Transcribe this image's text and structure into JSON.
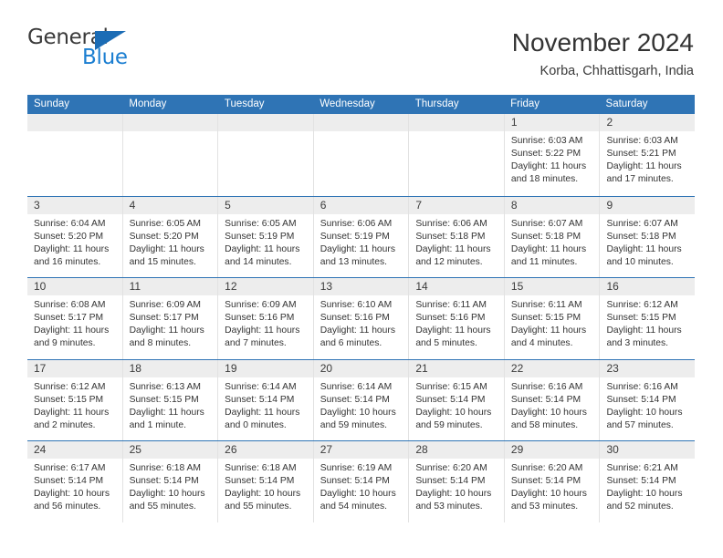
{
  "brand": {
    "name_part1": "General",
    "name_part2": "Blue",
    "triangle_color": "#1b6cb5",
    "blue_color": "#1b7ed1"
  },
  "header": {
    "title": "November 2024",
    "location": "Korba, Chhattisgarh, India"
  },
  "theme": {
    "header_bar": "#2f74b5",
    "daynum_band": "#ededed",
    "row_divider": "#2f74b5",
    "column_divider": "#e2e2e2"
  },
  "weekdays": [
    "Sunday",
    "Monday",
    "Tuesday",
    "Wednesday",
    "Thursday",
    "Friday",
    "Saturday"
  ],
  "weeks": [
    [
      {
        "day": "",
        "empty": true,
        "sunrise": "",
        "sunset": "",
        "daylight1": "",
        "daylight2": ""
      },
      {
        "day": "",
        "empty": true,
        "sunrise": "",
        "sunset": "",
        "daylight1": "",
        "daylight2": ""
      },
      {
        "day": "",
        "empty": true,
        "sunrise": "",
        "sunset": "",
        "daylight1": "",
        "daylight2": ""
      },
      {
        "day": "",
        "empty": true,
        "sunrise": "",
        "sunset": "",
        "daylight1": "",
        "daylight2": ""
      },
      {
        "day": "",
        "empty": true,
        "sunrise": "",
        "sunset": "",
        "daylight1": "",
        "daylight2": ""
      },
      {
        "day": "1",
        "empty": false,
        "sunrise": "Sunrise: 6:03 AM",
        "sunset": "Sunset: 5:22 PM",
        "daylight1": "Daylight: 11 hours",
        "daylight2": "and 18 minutes."
      },
      {
        "day": "2",
        "empty": false,
        "sunrise": "Sunrise: 6:03 AM",
        "sunset": "Sunset: 5:21 PM",
        "daylight1": "Daylight: 11 hours",
        "daylight2": "and 17 minutes."
      }
    ],
    [
      {
        "day": "3",
        "empty": false,
        "sunrise": "Sunrise: 6:04 AM",
        "sunset": "Sunset: 5:20 PM",
        "daylight1": "Daylight: 11 hours",
        "daylight2": "and 16 minutes."
      },
      {
        "day": "4",
        "empty": false,
        "sunrise": "Sunrise: 6:05 AM",
        "sunset": "Sunset: 5:20 PM",
        "daylight1": "Daylight: 11 hours",
        "daylight2": "and 15 minutes."
      },
      {
        "day": "5",
        "empty": false,
        "sunrise": "Sunrise: 6:05 AM",
        "sunset": "Sunset: 5:19 PM",
        "daylight1": "Daylight: 11 hours",
        "daylight2": "and 14 minutes."
      },
      {
        "day": "6",
        "empty": false,
        "sunrise": "Sunrise: 6:06 AM",
        "sunset": "Sunset: 5:19 PM",
        "daylight1": "Daylight: 11 hours",
        "daylight2": "and 13 minutes."
      },
      {
        "day": "7",
        "empty": false,
        "sunrise": "Sunrise: 6:06 AM",
        "sunset": "Sunset: 5:18 PM",
        "daylight1": "Daylight: 11 hours",
        "daylight2": "and 12 minutes."
      },
      {
        "day": "8",
        "empty": false,
        "sunrise": "Sunrise: 6:07 AM",
        "sunset": "Sunset: 5:18 PM",
        "daylight1": "Daylight: 11 hours",
        "daylight2": "and 11 minutes."
      },
      {
        "day": "9",
        "empty": false,
        "sunrise": "Sunrise: 6:07 AM",
        "sunset": "Sunset: 5:18 PM",
        "daylight1": "Daylight: 11 hours",
        "daylight2": "and 10 minutes."
      }
    ],
    [
      {
        "day": "10",
        "empty": false,
        "sunrise": "Sunrise: 6:08 AM",
        "sunset": "Sunset: 5:17 PM",
        "daylight1": "Daylight: 11 hours",
        "daylight2": "and 9 minutes."
      },
      {
        "day": "11",
        "empty": false,
        "sunrise": "Sunrise: 6:09 AM",
        "sunset": "Sunset: 5:17 PM",
        "daylight1": "Daylight: 11 hours",
        "daylight2": "and 8 minutes."
      },
      {
        "day": "12",
        "empty": false,
        "sunrise": "Sunrise: 6:09 AM",
        "sunset": "Sunset: 5:16 PM",
        "daylight1": "Daylight: 11 hours",
        "daylight2": "and 7 minutes."
      },
      {
        "day": "13",
        "empty": false,
        "sunrise": "Sunrise: 6:10 AM",
        "sunset": "Sunset: 5:16 PM",
        "daylight1": "Daylight: 11 hours",
        "daylight2": "and 6 minutes."
      },
      {
        "day": "14",
        "empty": false,
        "sunrise": "Sunrise: 6:11 AM",
        "sunset": "Sunset: 5:16 PM",
        "daylight1": "Daylight: 11 hours",
        "daylight2": "and 5 minutes."
      },
      {
        "day": "15",
        "empty": false,
        "sunrise": "Sunrise: 6:11 AM",
        "sunset": "Sunset: 5:15 PM",
        "daylight1": "Daylight: 11 hours",
        "daylight2": "and 4 minutes."
      },
      {
        "day": "16",
        "empty": false,
        "sunrise": "Sunrise: 6:12 AM",
        "sunset": "Sunset: 5:15 PM",
        "daylight1": "Daylight: 11 hours",
        "daylight2": "and 3 minutes."
      }
    ],
    [
      {
        "day": "17",
        "empty": false,
        "sunrise": "Sunrise: 6:12 AM",
        "sunset": "Sunset: 5:15 PM",
        "daylight1": "Daylight: 11 hours",
        "daylight2": "and 2 minutes."
      },
      {
        "day": "18",
        "empty": false,
        "sunrise": "Sunrise: 6:13 AM",
        "sunset": "Sunset: 5:15 PM",
        "daylight1": "Daylight: 11 hours",
        "daylight2": "and 1 minute."
      },
      {
        "day": "19",
        "empty": false,
        "sunrise": "Sunrise: 6:14 AM",
        "sunset": "Sunset: 5:14 PM",
        "daylight1": "Daylight: 11 hours",
        "daylight2": "and 0 minutes."
      },
      {
        "day": "20",
        "empty": false,
        "sunrise": "Sunrise: 6:14 AM",
        "sunset": "Sunset: 5:14 PM",
        "daylight1": "Daylight: 10 hours",
        "daylight2": "and 59 minutes."
      },
      {
        "day": "21",
        "empty": false,
        "sunrise": "Sunrise: 6:15 AM",
        "sunset": "Sunset: 5:14 PM",
        "daylight1": "Daylight: 10 hours",
        "daylight2": "and 59 minutes."
      },
      {
        "day": "22",
        "empty": false,
        "sunrise": "Sunrise: 6:16 AM",
        "sunset": "Sunset: 5:14 PM",
        "daylight1": "Daylight: 10 hours",
        "daylight2": "and 58 minutes."
      },
      {
        "day": "23",
        "empty": false,
        "sunrise": "Sunrise: 6:16 AM",
        "sunset": "Sunset: 5:14 PM",
        "daylight1": "Daylight: 10 hours",
        "daylight2": "and 57 minutes."
      }
    ],
    [
      {
        "day": "24",
        "empty": false,
        "sunrise": "Sunrise: 6:17 AM",
        "sunset": "Sunset: 5:14 PM",
        "daylight1": "Daylight: 10 hours",
        "daylight2": "and 56 minutes."
      },
      {
        "day": "25",
        "empty": false,
        "sunrise": "Sunrise: 6:18 AM",
        "sunset": "Sunset: 5:14 PM",
        "daylight1": "Daylight: 10 hours",
        "daylight2": "and 55 minutes."
      },
      {
        "day": "26",
        "empty": false,
        "sunrise": "Sunrise: 6:18 AM",
        "sunset": "Sunset: 5:14 PM",
        "daylight1": "Daylight: 10 hours",
        "daylight2": "and 55 minutes."
      },
      {
        "day": "27",
        "empty": false,
        "sunrise": "Sunrise: 6:19 AM",
        "sunset": "Sunset: 5:14 PM",
        "daylight1": "Daylight: 10 hours",
        "daylight2": "and 54 minutes."
      },
      {
        "day": "28",
        "empty": false,
        "sunrise": "Sunrise: 6:20 AM",
        "sunset": "Sunset: 5:14 PM",
        "daylight1": "Daylight: 10 hours",
        "daylight2": "and 53 minutes."
      },
      {
        "day": "29",
        "empty": false,
        "sunrise": "Sunrise: 6:20 AM",
        "sunset": "Sunset: 5:14 PM",
        "daylight1": "Daylight: 10 hours",
        "daylight2": "and 53 minutes."
      },
      {
        "day": "30",
        "empty": false,
        "sunrise": "Sunrise: 6:21 AM",
        "sunset": "Sunset: 5:14 PM",
        "daylight1": "Daylight: 10 hours",
        "daylight2": "and 52 minutes."
      }
    ]
  ]
}
